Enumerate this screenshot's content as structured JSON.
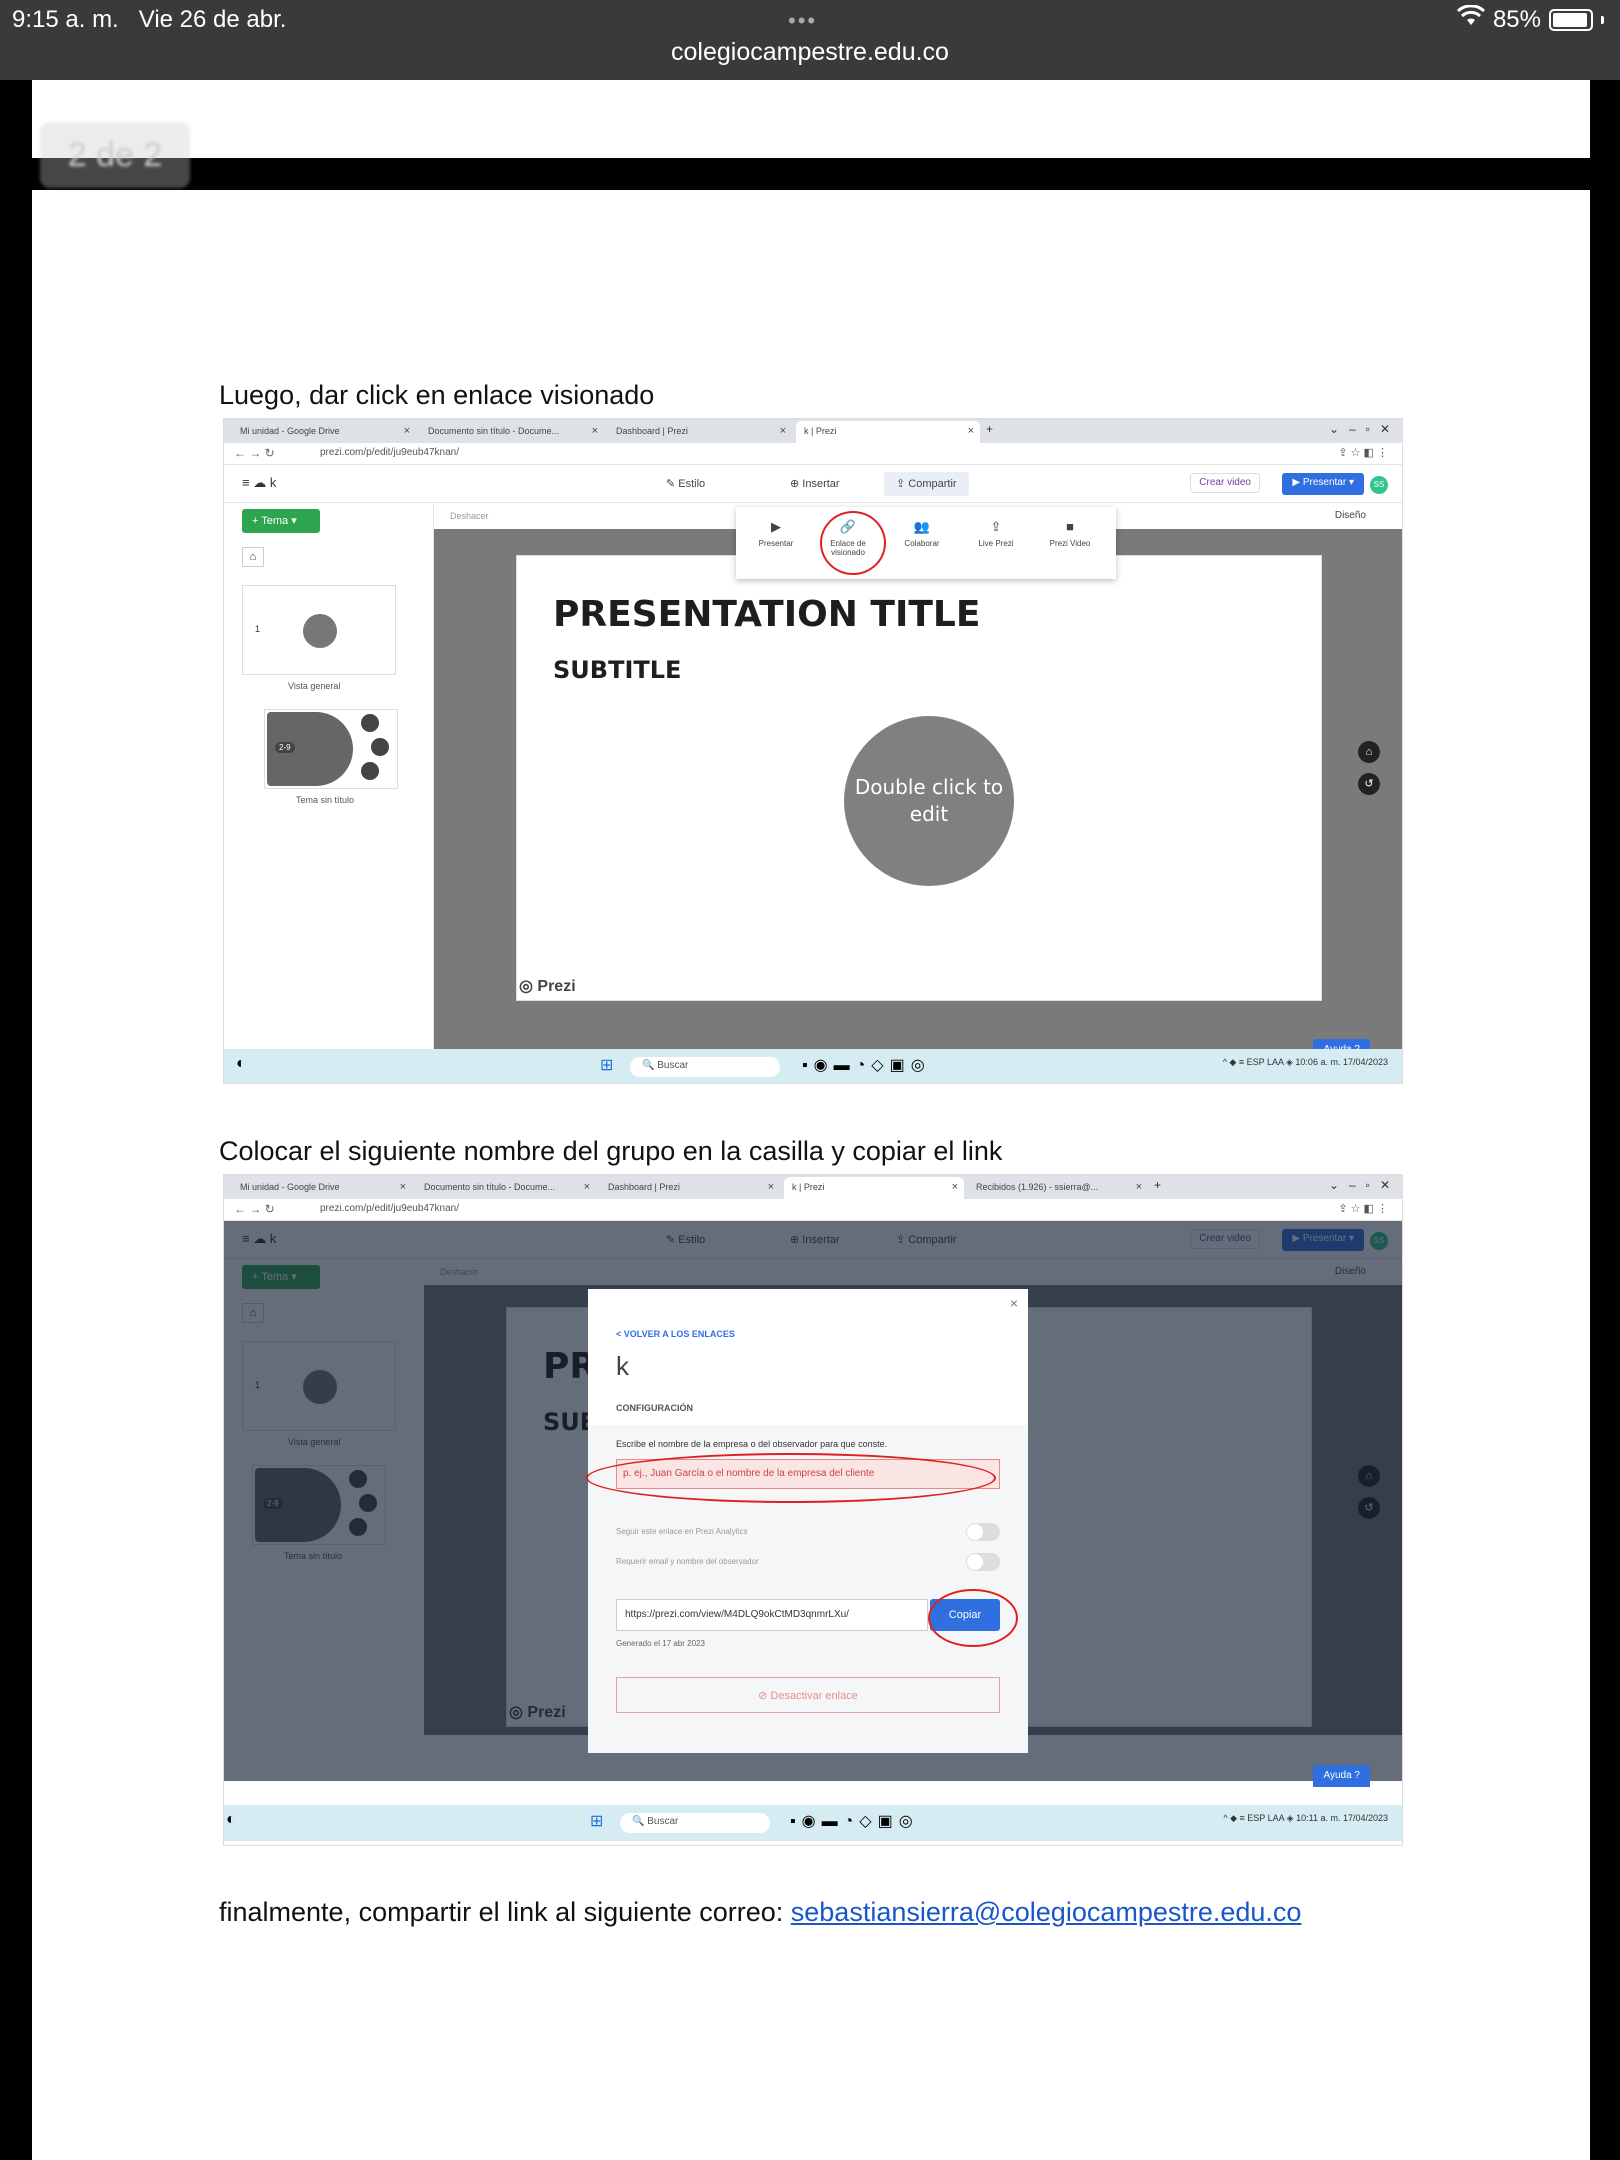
{
  "status_bar": {
    "time": "9:15 a. m.",
    "date": "Vie 26 de abr.",
    "battery": "85%",
    "url": "colegiocampestre.edu.co"
  },
  "pdf": {
    "page_badge": "2 de 2",
    "instruction_1": "Luego, dar click en  enlace visionado",
    "instruction_2": "Colocar el siguiente nombre del grupo en la casilla  y copiar el link",
    "instruction_3": "finalmente, compartir el link al siguiente correo: ",
    "email": "sebastiansierra@colegiocampestre.edu.co"
  },
  "screenshot1": {
    "tabs": [
      "Mi unidad - Google Drive",
      "Documento sin título - Docume...",
      "Dashboard | Prezi",
      "k | Prezi"
    ],
    "address": "prezi.com/p/edit/ju9eub47knan/",
    "toolbar": {
      "k": "k",
      "estilo": "Estilo",
      "insertar": "Insertar",
      "compartir": "Compartir",
      "crear_video": "Crear video",
      "presentar": "Presentar",
      "avatar": "SS"
    },
    "share_menu": [
      "Presentar",
      "Enlace de visionado",
      "Colaborar",
      "Live Prezi",
      "Prezi Video"
    ],
    "sidebar": {
      "tema": "Tema",
      "thumb1_num": "1",
      "thumb1_caption": "Vista general",
      "thumb2_label": "2-9",
      "thumb2_caption": "Tema sin título"
    },
    "canvas": {
      "deshacer": "Deshacer",
      "diseno": "Diseño",
      "slide_title": "PRESENTATION TITLE",
      "slide_subtitle": "SUBTITLE",
      "circle_text": "Double click to edit",
      "logo": "Prezi",
      "ayuda": "Ayuda"
    },
    "taskbar": {
      "search": "Buscar",
      "lang": "ESP LAA",
      "clock": "10:06 a. m. 17/04/2023"
    }
  },
  "screenshot2": {
    "tabs": [
      "Mi unidad - Google Drive",
      "Documento sin título - Docume...",
      "Dashboard | Prezi",
      "k | Prezi",
      "Recibidos (1.926) - ssierra@..."
    ],
    "address": "prezi.com/p/edit/ju9eub47knan/",
    "modal": {
      "back": "< VOLVER A LOS ENLACES",
      "title": "k",
      "section": "CONFIGURACIÓN",
      "field_label": "Escribe el nombre de la empresa o del observador para que conste.",
      "field_placeholder": "p. ej., Juan García o el nombre de la empresa del cliente",
      "option_1": "Seguir este enlace en Prezi Analytics",
      "option_2": "Requerir email y nombre del observador",
      "link": "https://prezi.com/view/M4DLQ9okCtMD3qnmrLXu/",
      "copy": "Copiar",
      "generated": "Generado el 17 abr 2023",
      "deactivate": "⊘ Desactivar enlace"
    },
    "taskbar": {
      "search": "Buscar",
      "lang": "ESP LAA",
      "clock": "10:11 a. m. 17/04/2023"
    }
  }
}
